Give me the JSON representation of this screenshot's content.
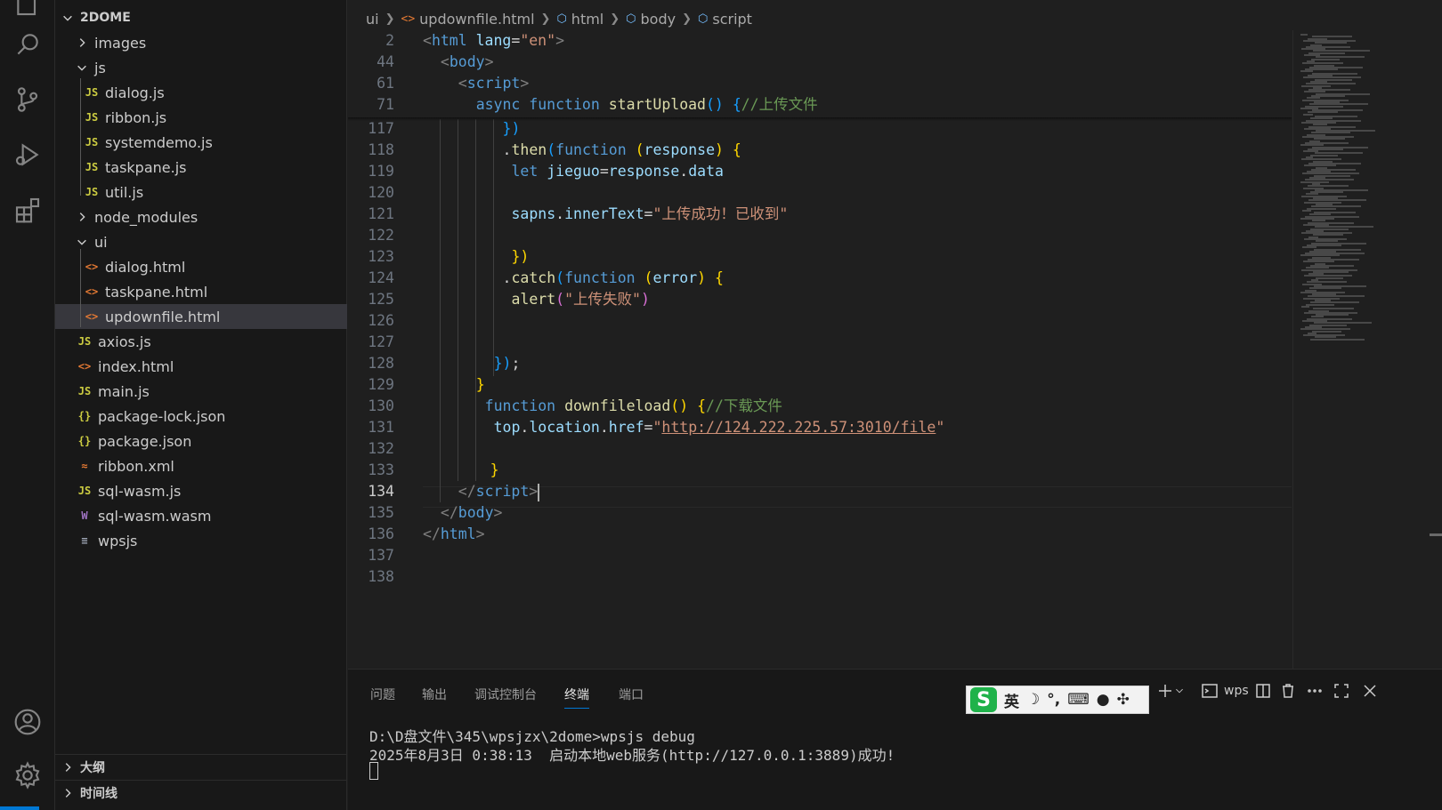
{
  "explorer": {
    "root": "2DOME",
    "items": [
      {
        "label": "images",
        "type": "folder",
        "open": false,
        "depth": 1
      },
      {
        "label": "js",
        "type": "folder",
        "open": true,
        "depth": 1
      },
      {
        "label": "dialog.js",
        "type": "js",
        "depth": 2
      },
      {
        "label": "ribbon.js",
        "type": "js",
        "depth": 2
      },
      {
        "label": "systemdemo.js",
        "type": "js",
        "depth": 2
      },
      {
        "label": "taskpane.js",
        "type": "js",
        "depth": 2
      },
      {
        "label": "util.js",
        "type": "js",
        "depth": 2
      },
      {
        "label": "node_modules",
        "type": "folder",
        "open": false,
        "depth": 1
      },
      {
        "label": "ui",
        "type": "folder",
        "open": true,
        "depth": 1
      },
      {
        "label": "dialog.html",
        "type": "html",
        "depth": 2
      },
      {
        "label": "taskpane.html",
        "type": "html",
        "depth": 2
      },
      {
        "label": "updownfile.html",
        "type": "html",
        "depth": 2,
        "selected": true
      },
      {
        "label": "axios.js",
        "type": "js",
        "depth": 1
      },
      {
        "label": "index.html",
        "type": "html",
        "depth": 1
      },
      {
        "label": "main.js",
        "type": "js",
        "depth": 1
      },
      {
        "label": "package-lock.json",
        "type": "json",
        "depth": 1
      },
      {
        "label": "package.json",
        "type": "json",
        "depth": 1
      },
      {
        "label": "ribbon.xml",
        "type": "xml",
        "depth": 1
      },
      {
        "label": "sql-wasm.js",
        "type": "js",
        "depth": 1
      },
      {
        "label": "sql-wasm.wasm",
        "type": "wasm",
        "depth": 1
      },
      {
        "label": "wpsjs",
        "type": "plain",
        "depth": 1
      }
    ],
    "icon_glyphs": {
      "js": "JS",
      "html": "<>",
      "json": "{}",
      "xml": "≈",
      "wasm": "W",
      "plain": "≡"
    },
    "outline_label": "大纲",
    "timeline_label": "时间线"
  },
  "breadcrumb": {
    "folder": "ui",
    "file": "updownfile.html",
    "html": "html",
    "body": "body",
    "script": "script"
  },
  "editor": {
    "sticky_lines": [
      {
        "n": "2",
        "tokens": [
          [
            "tg",
            "<"
          ],
          [
            "tn",
            "html"
          ],
          [
            "pl",
            " "
          ],
          [
            "at",
            "lang"
          ],
          [
            "pl",
            "="
          ],
          [
            "st",
            "\"en\""
          ],
          [
            "tg",
            ">"
          ]
        ],
        "indent": 0
      },
      {
        "n": "44",
        "tokens": [
          [
            "tg",
            "<"
          ],
          [
            "tn",
            "body"
          ],
          [
            "tg",
            ">"
          ]
        ],
        "indent": 1
      },
      {
        "n": "61",
        "tokens": [
          [
            "tg",
            "<"
          ],
          [
            "tn",
            "script"
          ],
          [
            "tg",
            ">"
          ]
        ],
        "indent": 2
      },
      {
        "n": "71",
        "tokens": [
          [
            "kw",
            "async"
          ],
          [
            "pl",
            " "
          ],
          [
            "kw",
            "function"
          ],
          [
            "pl",
            " "
          ],
          [
            "fn",
            "startUpload"
          ],
          [
            "br3",
            "()"
          ],
          [
            "pl",
            " "
          ],
          [
            "br3",
            "{"
          ],
          [
            "cm",
            "//上传文件"
          ]
        ],
        "indent": 3
      }
    ],
    "lines": [
      {
        "n": "117",
        "tokens": [
          [
            "br3",
            "})"
          ]
        ],
        "indent": 4.5
      },
      {
        "n": "118",
        "tokens": [
          [
            "pl",
            "."
          ],
          [
            "fn",
            "then"
          ],
          [
            "br3",
            "("
          ],
          [
            "kw",
            "function"
          ],
          [
            "pl",
            " "
          ],
          [
            "br1",
            "("
          ],
          [
            "va",
            "response"
          ],
          [
            "br1",
            ")"
          ],
          [
            "pl",
            " "
          ],
          [
            "br1",
            "{"
          ]
        ],
        "indent": 4.5
      },
      {
        "n": "119",
        "tokens": [
          [
            "kw",
            "let"
          ],
          [
            "pl",
            " "
          ],
          [
            "va",
            "jieguo"
          ],
          [
            "pl",
            "="
          ],
          [
            "va",
            "response"
          ],
          [
            "pl",
            "."
          ],
          [
            "va",
            "data"
          ]
        ],
        "indent": 5
      },
      {
        "n": "120",
        "tokens": [],
        "indent": 0
      },
      {
        "n": "121",
        "tokens": [
          [
            "va",
            "sapns"
          ],
          [
            "pl",
            "."
          ],
          [
            "va",
            "innerText"
          ],
          [
            "pl",
            "="
          ],
          [
            "st",
            "\"上传成功！已收到\""
          ]
        ],
        "indent": 5
      },
      {
        "n": "122",
        "tokens": [],
        "indent": 0
      },
      {
        "n": "123",
        "tokens": [
          [
            "br1",
            "})"
          ]
        ],
        "indent": 5
      },
      {
        "n": "124",
        "tokens": [
          [
            "pl",
            "."
          ],
          [
            "fn",
            "catch"
          ],
          [
            "br3",
            "("
          ],
          [
            "kw",
            "function"
          ],
          [
            "pl",
            " "
          ],
          [
            "br1",
            "("
          ],
          [
            "va",
            "error"
          ],
          [
            "br1",
            ")"
          ],
          [
            "pl",
            " "
          ],
          [
            "br1",
            "{"
          ]
        ],
        "indent": 4.5
      },
      {
        "n": "125",
        "tokens": [
          [
            "fn",
            "alert"
          ],
          [
            "br2",
            "("
          ],
          [
            "st",
            "\"上传失败\""
          ],
          [
            "br2",
            ")"
          ]
        ],
        "indent": 5
      },
      {
        "n": "126",
        "tokens": [],
        "indent": 0
      },
      {
        "n": "127",
        "tokens": [],
        "indent": 0
      },
      {
        "n": "128",
        "tokens": [
          [
            "br3",
            "})"
          ],
          [
            "pl",
            ";"
          ]
        ],
        "indent": 4
      },
      {
        "n": "129",
        "tokens": [
          [
            "br1",
            "}"
          ]
        ],
        "indent": 3
      },
      {
        "n": "130",
        "tokens": [
          [
            "kw",
            "function"
          ],
          [
            "pl",
            " "
          ],
          [
            "fn",
            "downfileload"
          ],
          [
            "br1",
            "()"
          ],
          [
            "pl",
            " "
          ],
          [
            "br1",
            "{"
          ],
          [
            "cm",
            "//下载文件"
          ]
        ],
        "indent": 3.5
      },
      {
        "n": "131",
        "tokens": [
          [
            "va",
            "top"
          ],
          [
            "pl",
            "."
          ],
          [
            "va",
            "location"
          ],
          [
            "pl",
            "."
          ],
          [
            "va",
            "href"
          ],
          [
            "pl",
            "="
          ],
          [
            "st",
            "\""
          ],
          [
            "link",
            "http://124.222.225.57:3010/file"
          ],
          [
            "st",
            "\""
          ]
        ],
        "indent": 4
      },
      {
        "n": "132",
        "tokens": [],
        "indent": 0
      },
      {
        "n": "133",
        "tokens": [
          [
            "br1",
            "}"
          ]
        ],
        "indent": 3.8
      },
      {
        "n": "134",
        "tokens": [
          [
            "tg",
            "</"
          ],
          [
            "tn",
            "script"
          ],
          [
            "tg",
            ">"
          ],
          [
            "cursor",
            ""
          ]
        ],
        "indent": 2,
        "active": true
      },
      {
        "n": "135",
        "tokens": [
          [
            "tg",
            "</"
          ],
          [
            "tn",
            "body"
          ],
          [
            "tg",
            ">"
          ]
        ],
        "indent": 1
      },
      {
        "n": "136",
        "tokens": [
          [
            "tg",
            "</"
          ],
          [
            "tn",
            "html"
          ],
          [
            "tg",
            ">"
          ]
        ],
        "indent": 0
      },
      {
        "n": "137",
        "tokens": [],
        "indent": 0
      },
      {
        "n": "138",
        "tokens": [],
        "indent": 0
      }
    ]
  },
  "panel": {
    "tabs": [
      "问题",
      "输出",
      "调试控制台",
      "终端",
      "端口"
    ],
    "active_tab": "终端",
    "terminal_name": "wps",
    "terminal_lines": [
      "D:\\D盘文件\\345\\wpsjzx\\2dome>wpsjs debug",
      "2025年8月3日 0:38:13  启动本地web服务(http://127.0.0.1:3889)成功!"
    ],
    "ime": {
      "logo": "S",
      "lang": "英",
      "moon": "☽",
      "punct": "°,",
      "keyboard": "⌨",
      "user": "●",
      "grid": "✣"
    }
  }
}
